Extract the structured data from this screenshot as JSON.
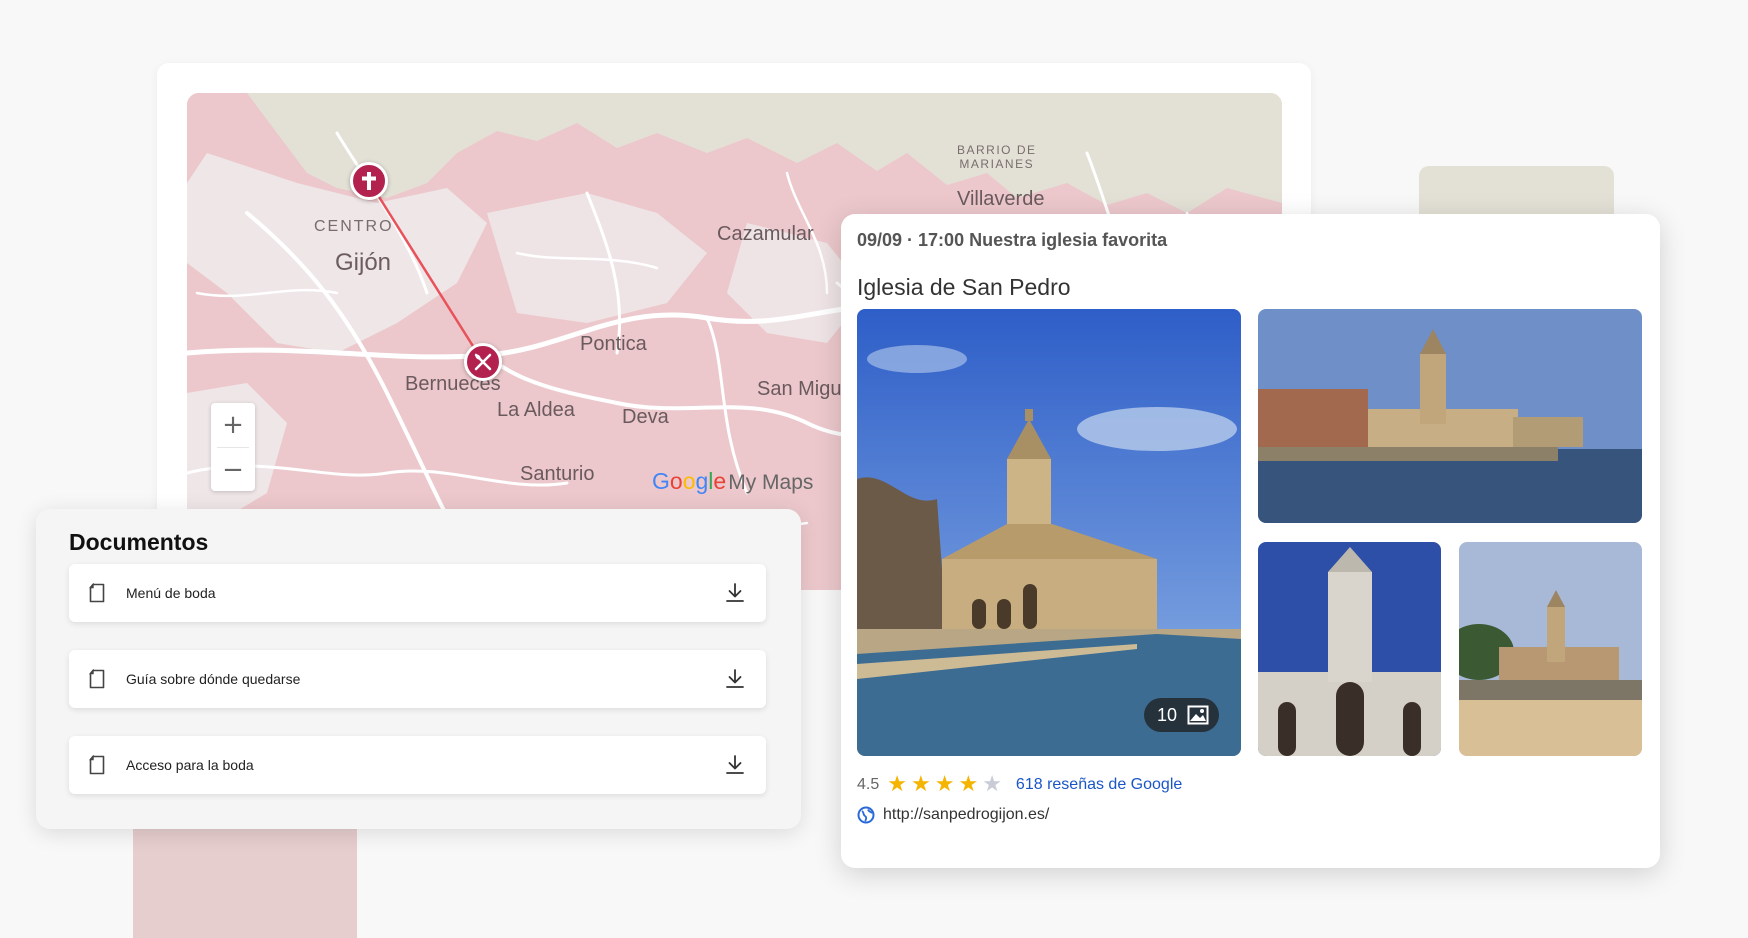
{
  "map": {
    "labels": {
      "centro": "CENTRO",
      "gijon": "Gijón",
      "cazamular": "Cazamular",
      "barrio_line1": "BARRIO DE",
      "barrio_line2": "MARIANES",
      "villaverde": "Villaverde",
      "pontica": "Pontica",
      "san_miguel": "San Migu",
      "bernueces": "Bernueces",
      "la_aldea": "La Aldea",
      "deva": "Deva",
      "santurio": "Santurio"
    },
    "attribution": {
      "g1": "G",
      "o1": "o",
      "o2": "o",
      "g2": "g",
      "l": "l",
      "e": "e",
      "mymaps": "My Maps"
    },
    "zoom_in_label": "+",
    "zoom_out_label": "−",
    "pins": [
      {
        "name": "church-pin",
        "icon": "cross-icon"
      },
      {
        "name": "restaurant-pin",
        "icon": "fork-knife-icon"
      }
    ],
    "colors": {
      "pin": "#b3214f",
      "route": "#e8525a",
      "land": "#ecc8cc",
      "sea": "#e3e1d6"
    }
  },
  "documents": {
    "title": "Documentos",
    "items": [
      {
        "label": "Menú de boda",
        "icon": "file-icon",
        "action_icon": "download-icon"
      },
      {
        "label": "Guía sobre dónde quedarse",
        "icon": "file-icon",
        "action_icon": "download-icon"
      },
      {
        "label": "Acceso para la boda",
        "icon": "file-icon",
        "action_icon": "download-icon"
      }
    ]
  },
  "place": {
    "event": "09/09 · 17:00 Nuestra iglesia favorita",
    "name": "Iglesia de San Pedro",
    "photo_count": "10",
    "rating": "4.5",
    "stars": {
      "value": 4,
      "max": 5,
      "filled_color": "#f4b400",
      "empty_color": "#c9ccd6"
    },
    "reviews": "618 reseñas de Google",
    "website": "http://sanpedrogijon.es/"
  }
}
